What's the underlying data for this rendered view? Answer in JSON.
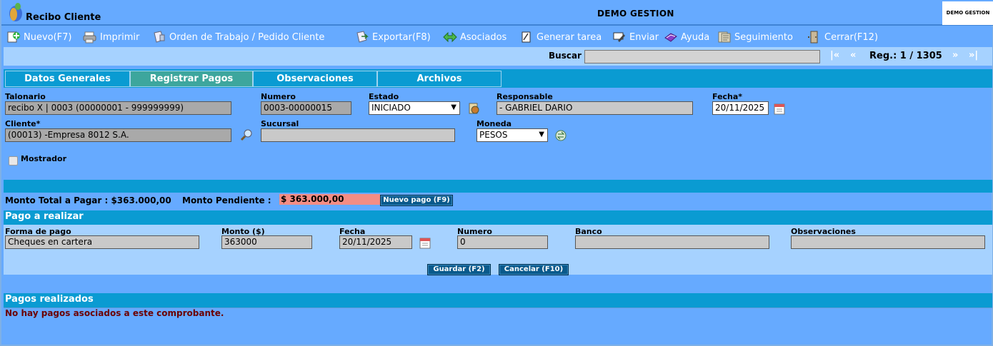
{
  "window": {
    "app_title": "Recibo Cliente",
    "company": "DEMO GESTION",
    "brand_box": "DEMO GESTION"
  },
  "toolbar": {
    "items": [
      {
        "label": "Nuevo(F7)",
        "icon": "add-icon"
      },
      {
        "label": "Imprimir",
        "icon": "printer-icon"
      },
      {
        "label": "Orden de Trabajo / Pedido Cliente",
        "icon": "document-icon"
      },
      {
        "label": "Exportar(F8)",
        "icon": "export-icon"
      },
      {
        "label": "Asociados",
        "icon": "associates-icon"
      },
      {
        "label": "Generar tarea",
        "icon": "task-icon"
      },
      {
        "label": "Enviar",
        "icon": "send-icon"
      },
      {
        "label": "Ayuda",
        "icon": "help-book-icon"
      },
      {
        "label": "Seguimiento",
        "icon": "tracking-icon"
      },
      {
        "label": "Cerrar(F12)",
        "icon": "close-door-icon"
      }
    ]
  },
  "search": {
    "label": "Buscar",
    "value": "",
    "nav_first": "|«",
    "nav_prev": "«",
    "record": "Reg.: 1 / 1305",
    "nav_next": "»",
    "nav_last": "»|"
  },
  "tabs": [
    {
      "label": "Datos Generales",
      "active": false
    },
    {
      "label": "Registrar Pagos",
      "active": true
    },
    {
      "label": "Observaciones",
      "active": false
    },
    {
      "label": "Archivos",
      "active": false
    }
  ],
  "form": {
    "talonario": {
      "label": "Talonario",
      "value": "recibo X | 0003 (00000001 - 999999999)"
    },
    "numero": {
      "label": "Numero",
      "value": "0003-00000015"
    },
    "estado": {
      "label": "Estado",
      "value": "INICIADO"
    },
    "responsable": {
      "label": "Responsable",
      "value": "- GABRIEL DARIO"
    },
    "fecha": {
      "label": "Fecha*",
      "value": "20/11/2025"
    },
    "cliente": {
      "label": "Cliente*",
      "value": "(00013) -Empresa 8012 S.A."
    },
    "sucursal": {
      "label": "Sucursal",
      "value": ""
    },
    "moneda": {
      "label": "Moneda",
      "value": "PESOS"
    },
    "mostrador": {
      "label": "Mostrador",
      "checked": false
    }
  },
  "totals": {
    "total_label": "Monto Total a Pagar : $363.000,00",
    "pending_label": "Monto Pendiente :",
    "pending_value": "$ 363.000,00",
    "new_payment_button": "Nuevo pago (F9)"
  },
  "payment": {
    "section_title": "Pago a realizar",
    "forma_label": "Forma de pago",
    "forma_value": "Cheques en cartera",
    "monto_label": "Monto ($)",
    "monto_value": "363000",
    "fecha_label": "Fecha",
    "fecha_value": "20/11/2025",
    "numero_label": "Numero",
    "numero_value": "0",
    "banco_label": "Banco",
    "banco_value": "",
    "obs_label": "Observaciones",
    "obs_value": "",
    "save_button": "Guardar (F2)",
    "cancel_button": "Cancelar (F10)"
  },
  "payments_done": {
    "section_title": "Pagos realizados",
    "empty_message": "No hay pagos asociados a este comprobante."
  },
  "colors": {
    "background": "#66aaff",
    "tab_strip": "#0a9bd2",
    "active_tab": "#3da69d",
    "pending_highlight": "#f48d84",
    "button": "#0a5a8c"
  }
}
